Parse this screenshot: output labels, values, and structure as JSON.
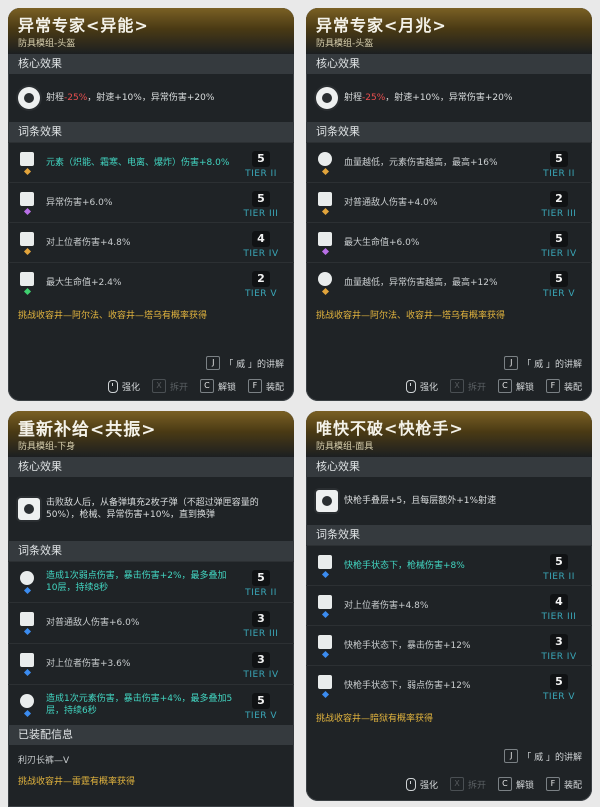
{
  "cards": [
    {
      "title": "异常专家<异能>",
      "subtitle": "防具模组-头盔",
      "core_header": "核心效果",
      "core": {
        "prefix": "射程",
        "red": "-25%",
        "rest": "，射速+10%，异常伤害+20%",
        "icon": "gear-cluster-icon"
      },
      "affix_header": "词条效果",
      "affixes": [
        {
          "icon": "flame-figure-icon",
          "text": "元素（炽能、霜寒、电离、爆炸）伤害+8.0%",
          "tier": "5",
          "tier_label": "TIER II",
          "highlight": true,
          "dot": "#e2a43b"
        },
        {
          "icon": "cluster-figure-icon",
          "text": "异常伤害+6.0%",
          "tier": "5",
          "tier_label": "TIER III",
          "highlight": false,
          "dot": "#b86fe6"
        },
        {
          "icon": "crown-figure-icon",
          "text": "对上位者伤害+4.8%",
          "tier": "4",
          "tier_label": "TIER IV",
          "highlight": false,
          "dot": "#e2a43b"
        },
        {
          "icon": "heart-icon",
          "text": "最大生命值+2.4%",
          "tier": "2",
          "tier_label": "TIER V",
          "highlight": false,
          "dot": "#3fd06f"
        }
      ],
      "obtain": "挑战收容井—阿尔法、收容井—塔乌有概率获得",
      "hint_key": "J",
      "hint_text": "「 威 」的讲解",
      "actions": [
        {
          "label": "强化",
          "key": "",
          "mouse": true,
          "dim": false
        },
        {
          "label": "拆开",
          "key": "X",
          "mouse": false,
          "dim": true
        },
        {
          "label": "解锁",
          "key": "C",
          "mouse": false,
          "dim": false
        },
        {
          "label": "装配",
          "key": "F",
          "mouse": false,
          "dim": false
        }
      ]
    },
    {
      "title": "异常专家<月兆>",
      "subtitle": "防具模组-头盔",
      "core_header": "核心效果",
      "core": {
        "prefix": "射程",
        "red": "-25%",
        "rest": "，射速+10%，异常伤害+20%",
        "icon": "gear-cluster-icon"
      },
      "affix_header": "词条效果",
      "affixes": [
        {
          "icon": "moon-icon",
          "text": "血量越低，元素伤害越高，最高+16%",
          "tier": "5",
          "tier_label": "TIER II",
          "highlight": false,
          "dot": "#e2a43b"
        },
        {
          "icon": "fist-icon",
          "text": "对普通敌人伤害+4.0%",
          "tier": "2",
          "tier_label": "TIER III",
          "highlight": false,
          "dot": "#e2a43b"
        },
        {
          "icon": "heart-icon",
          "text": "最大生命值+6.0%",
          "tier": "5",
          "tier_label": "TIER IV",
          "highlight": false,
          "dot": "#b86fe6"
        },
        {
          "icon": "moon-icon",
          "text": "血量越低，异常伤害越高，最高+12%",
          "tier": "5",
          "tier_label": "TIER V",
          "highlight": false,
          "dot": "#e2a43b"
        }
      ],
      "obtain": "挑战收容井—阿尔法、收容井—塔乌有概率获得",
      "hint_key": "J",
      "hint_text": "「 威 」的讲解",
      "actions": [
        {
          "label": "强化",
          "key": "",
          "mouse": true,
          "dim": false
        },
        {
          "label": "拆开",
          "key": "X",
          "mouse": false,
          "dim": true
        },
        {
          "label": "解锁",
          "key": "C",
          "mouse": false,
          "dim": false
        },
        {
          "label": "装配",
          "key": "F",
          "mouse": false,
          "dim": false
        }
      ]
    },
    {
      "title": "重新补给<共振>",
      "subtitle": "防具模组-下身",
      "core_header": "核心效果",
      "core": {
        "prefix": "",
        "red": "",
        "rest": "击败敌人后，从备弹填充2枚子弹（不超过弹匣容量的50%），枪械、异常伤害+10%，直到换弹",
        "icon": "ammo-icon"
      },
      "affix_header": "词条效果",
      "affixes": [
        {
          "icon": "swirl-icon",
          "text": "造成1次弱点伤害，暴击伤害+2%，最多叠加10层，持续8秒",
          "tier": "5",
          "tier_label": "TIER II",
          "highlight": true,
          "dot": "#3b8cf0"
        },
        {
          "icon": "fist-icon",
          "text": "对普通敌人伤害+6.0%",
          "tier": "3",
          "tier_label": "TIER III",
          "highlight": false,
          "dot": "#3b8cf0"
        },
        {
          "icon": "crown-figure-icon",
          "text": "对上位者伤害+3.6%",
          "tier": "3",
          "tier_label": "TIER IV",
          "highlight": false,
          "dot": "#3b8cf0"
        },
        {
          "icon": "swirl-icon",
          "text": "造成1次元素伤害，暴击伤害+4%，最多叠加5层，持续6秒",
          "tier": "5",
          "tier_label": "TIER V",
          "highlight": true,
          "dot": "#3b8cf0"
        }
      ],
      "equipped_header": "已装配信息",
      "equipped_value": "利刃长裤—V",
      "obtain": "挑战收容井—雷霆有概率获得"
    },
    {
      "title": "唯快不破<快枪手>",
      "subtitle": "防具模组-面具",
      "core_header": "核心效果",
      "core": {
        "prefix": "",
        "red": "",
        "rest": "快枪手叠层+5，且每层额外+1%射速",
        "icon": "gunslinger-icon"
      },
      "affix_header": "词条效果",
      "affixes": [
        {
          "icon": "gunslinger-icon",
          "text": "快枪手状态下，枪械伤害+8%",
          "tier": "5",
          "tier_label": "TIER II",
          "highlight": true,
          "dot": "#3b8cf0"
        },
        {
          "icon": "crown-figure-icon",
          "text": "对上位者伤害+4.8%",
          "tier": "4",
          "tier_label": "TIER III",
          "highlight": false,
          "dot": "#3b8cf0"
        },
        {
          "icon": "gunslinger-icon",
          "text": "快枪手状态下，暴击伤害+12%",
          "tier": "3",
          "tier_label": "TIER IV",
          "highlight": false,
          "dot": "#3b8cf0"
        },
        {
          "icon": "gunslinger-icon",
          "text": "快枪手状态下，弱点伤害+12%",
          "tier": "5",
          "tier_label": "TIER V",
          "highlight": false,
          "dot": "#3b8cf0"
        }
      ],
      "obtain": "挑战收容井—暗狱有概率获得",
      "hint_key": "J",
      "hint_text": "「 威 」的讲解",
      "actions": [
        {
          "label": "强化",
          "key": "",
          "mouse": true,
          "dim": false
        },
        {
          "label": "拆开",
          "key": "X",
          "mouse": false,
          "dim": true
        },
        {
          "label": "解锁",
          "key": "C",
          "mouse": false,
          "dim": false
        },
        {
          "label": "装配",
          "key": "F",
          "mouse": false,
          "dim": false
        }
      ]
    }
  ]
}
